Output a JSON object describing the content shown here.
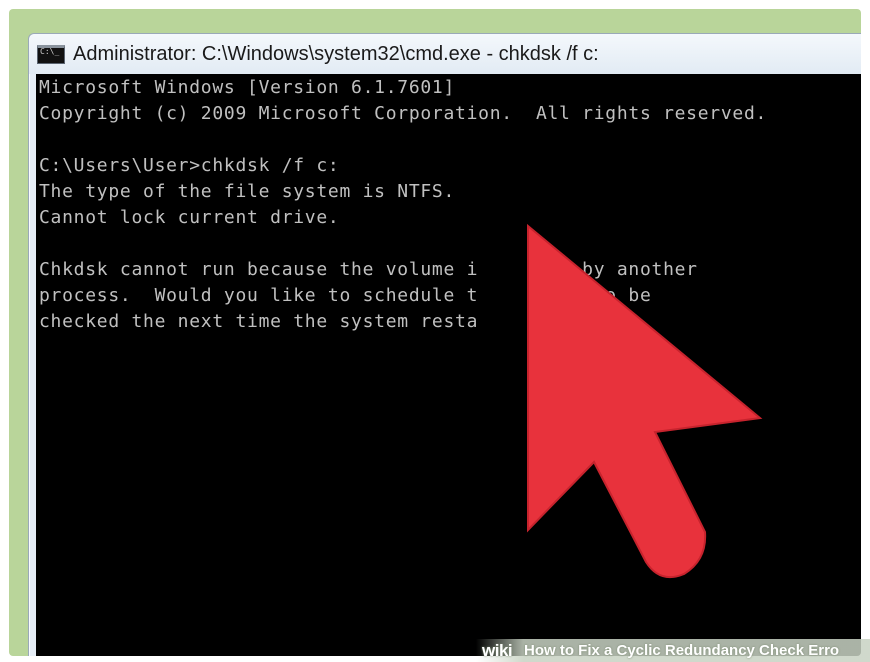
{
  "window": {
    "title": "Administrator: C:\\Windows\\system32\\cmd.exe - chkdsk  /f c:",
    "icon": "cmd-icon"
  },
  "console": {
    "lines": [
      "Microsoft Windows [Version 6.1.7601]",
      "Copyright (c) 2009 Microsoft Corporation.  All rights reserved.",
      "",
      "C:\\Users\\User>chkdsk /f c:",
      "The type of the file system is NTFS.",
      "Cannot lock current drive.",
      "",
      "Chkdsk cannot run because the volume i      se by another",
      "process.  Would you like to schedule t       me to be",
      "checked the next time the system resta"
    ],
    "text_color": "#c0c0c0",
    "background": "#000000"
  },
  "overlay": {
    "pointer": "red-arrow-pointer",
    "pointer_color": "#e8323c"
  },
  "watermark": {
    "logo": "wiki",
    "text": "How to Fix a Cyclic Redundancy Check Erro"
  }
}
